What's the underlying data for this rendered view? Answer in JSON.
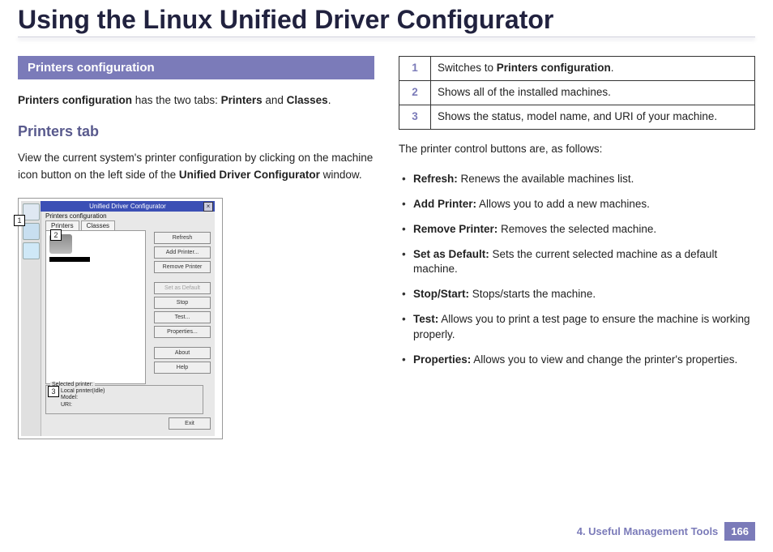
{
  "page_title": "Using the Linux Unified Driver Configurator",
  "left": {
    "section_header": "Printers configuration",
    "intro_pre": "Printers configuration",
    "intro_mid": " has the two tabs: ",
    "intro_b1": "Printers",
    "intro_and": " and ",
    "intro_b2": "Classes",
    "intro_post": ".",
    "sub_heading": "Printers tab",
    "para_pre": "View the current system's printer configuration by clicking on the machine icon button on the left side of the ",
    "para_bold": "Unified Driver Configurator",
    "para_post": " window."
  },
  "shot": {
    "title": "Unified Driver Configurator",
    "panel_title": "Printers configuration",
    "tab1": "Printers",
    "tab2": "Classes",
    "buttons": [
      "Refresh",
      "Add Printer...",
      "Remove Printer",
      "Set as Default",
      "Stop",
      "Test...",
      "Properties..."
    ],
    "buttons2": [
      "About",
      "Help"
    ],
    "status_label": "Selected printer:",
    "status_lines": [
      "Local printer(Idle)",
      "Model:",
      "URI:"
    ],
    "exit": "Exit",
    "callouts": {
      "c1": "1",
      "c2": "2",
      "c3": "3"
    }
  },
  "right": {
    "legend": [
      {
        "n": "1",
        "pre": "Switches to ",
        "b": "Printers configuration",
        "post": "."
      },
      {
        "n": "2",
        "pre": "Shows all of the installed machines.",
        "b": "",
        "post": ""
      },
      {
        "n": "3",
        "pre": "Shows the status, model name, and URI of your machine.",
        "b": "",
        "post": ""
      }
    ],
    "intro": "The printer control buttons are, as follows:",
    "items": [
      {
        "b": "Refresh:",
        "t": " Renews the available machines list."
      },
      {
        "b": "Add Printer:",
        "t": " Allows you to add a new machines."
      },
      {
        "b": "Remove Printer:",
        "t": " Removes the selected machine."
      },
      {
        "b": "Set as Default:",
        "t": " Sets the current selected machine as a default machine."
      },
      {
        "b": "Stop/Start:",
        "t": " Stops/starts the machine."
      },
      {
        "b": "Test:",
        "t": " Allows you to print a test page to ensure the machine is working properly."
      },
      {
        "b": "Properties:",
        "t": " Allows you to view and change the printer's properties."
      }
    ]
  },
  "footer": {
    "chapter": "4.  Useful Management Tools",
    "page": "166"
  }
}
